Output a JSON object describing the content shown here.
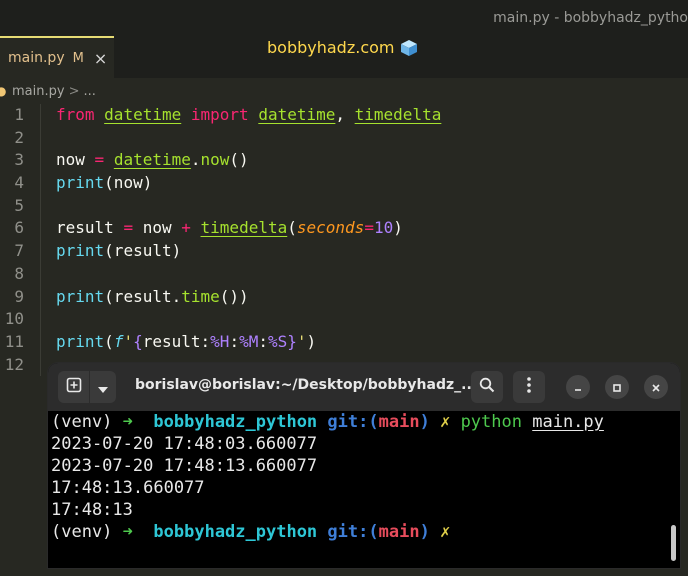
{
  "window_title": "main.py - bobbyhadz_pytho",
  "site_brand": "bobbyhadz.com",
  "tab": {
    "label": "main.py",
    "status": "M",
    "close": "×"
  },
  "breadcrumb": {
    "file": "main.py",
    "sep": ">",
    "more": "..."
  },
  "code_lines": [
    {
      "no": "1",
      "tokens": [
        [
          "kw",
          "from"
        ],
        [
          "pw",
          " "
        ],
        [
          "cls",
          "datetime"
        ],
        [
          "pw",
          " "
        ],
        [
          "kw",
          "import"
        ],
        [
          "pw",
          " "
        ],
        [
          "cls",
          "datetime"
        ],
        [
          "pw",
          ", "
        ],
        [
          "cls",
          "timedelta"
        ]
      ]
    },
    {
      "no": "2",
      "tokens": []
    },
    {
      "no": "3",
      "tokens": [
        [
          "pw",
          "now "
        ],
        [
          "op",
          "="
        ],
        [
          "pw",
          " "
        ],
        [
          "cls",
          "datetime"
        ],
        [
          "pw",
          "."
        ],
        [
          "fn",
          "now"
        ],
        [
          "pw",
          "()"
        ]
      ]
    },
    {
      "no": "4",
      "tokens": [
        [
          "bi",
          "print"
        ],
        [
          "pw",
          "(now)"
        ]
      ]
    },
    {
      "no": "5",
      "tokens": []
    },
    {
      "no": "6",
      "tokens": [
        [
          "pw",
          "result "
        ],
        [
          "op",
          "="
        ],
        [
          "pw",
          " now "
        ],
        [
          "op",
          "+"
        ],
        [
          "pw",
          " "
        ],
        [
          "cls",
          "timedelta"
        ],
        [
          "pw",
          "("
        ],
        [
          "param",
          "seconds"
        ],
        [
          "op",
          "="
        ],
        [
          "num",
          "10"
        ],
        [
          "pw",
          ")"
        ]
      ]
    },
    {
      "no": "7",
      "tokens": [
        [
          "bi",
          "print"
        ],
        [
          "pw",
          "(result)"
        ]
      ]
    },
    {
      "no": "8",
      "tokens": []
    },
    {
      "no": "9",
      "tokens": [
        [
          "bi",
          "print"
        ],
        [
          "pw",
          "(result."
        ],
        [
          "fn",
          "time"
        ],
        [
          "pw",
          "())"
        ]
      ]
    },
    {
      "no": "10",
      "tokens": []
    },
    {
      "no": "11",
      "tokens": [
        [
          "bi",
          "print"
        ],
        [
          "pw",
          "("
        ],
        [
          "fstr-prefix",
          "f"
        ],
        [
          "str",
          "'"
        ],
        [
          "brace",
          "{"
        ],
        [
          "pw",
          "result:"
        ],
        [
          "fmt",
          "%H"
        ],
        [
          "pw",
          ":"
        ],
        [
          "fmt",
          "%M"
        ],
        [
          "pw",
          ":"
        ],
        [
          "fmt",
          "%S"
        ],
        [
          "brace",
          "}"
        ],
        [
          "str",
          "'"
        ],
        [
          "pw",
          ")"
        ]
      ]
    },
    {
      "no": "12",
      "tokens": []
    }
  ],
  "terminal": {
    "title": "borislav@borislav:~/Desktop/bobbyhadz_...",
    "prompt": {
      "venv": "(venv)",
      "arrow": "➜",
      "dir": "bobbyhadz_python",
      "git": "git:(",
      "branch": "main",
      "git_close": ")",
      "dirty": "✗"
    },
    "command": "python",
    "argument": "main.py",
    "output": [
      "2023-07-20 17:48:03.660077",
      "2023-07-20 17:48:13.660077",
      "17:48:13.660077",
      "17:48:13"
    ]
  },
  "icons": {
    "new_tab": "new-tab-icon",
    "dropdown": "chevron-down-icon",
    "search": "search-icon",
    "menu": "kebab-menu-icon",
    "minimize": "minimize-icon",
    "maximize": "maximize-icon",
    "close": "close-icon",
    "python_file": "python-file-icon",
    "brand": "ice-cube-icon"
  },
  "colors": {
    "editor_bg": "#272822",
    "keyword": "#f92672",
    "class": "#a6e22e",
    "builtin": "#66d9ef",
    "number": "#ae81ff",
    "string": "#e6db74",
    "terminal_bg": "#000000"
  }
}
